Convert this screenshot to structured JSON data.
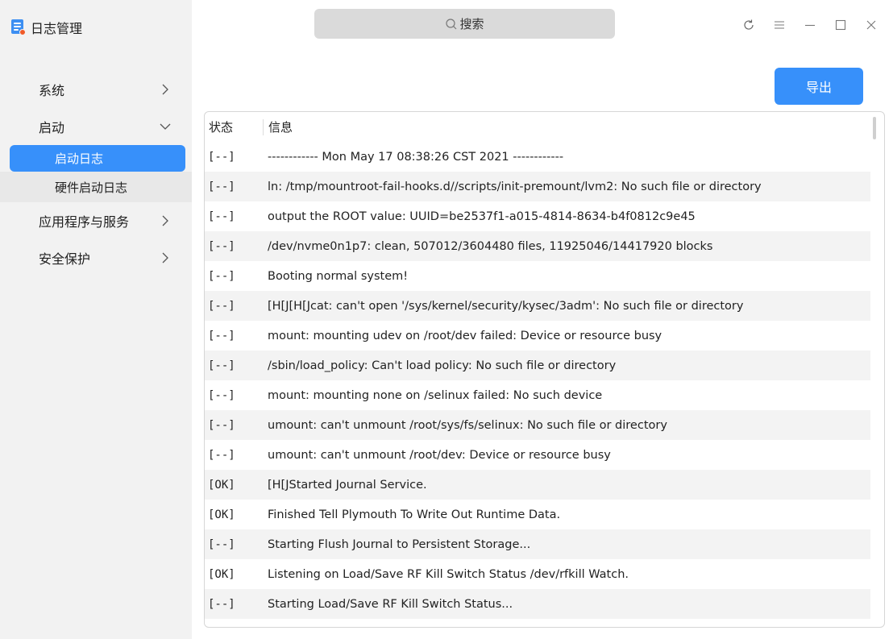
{
  "app": {
    "title": "日志管理"
  },
  "search": {
    "placeholder": "搜索"
  },
  "window_controls": [
    "refresh-icon",
    "menu-icon",
    "minimize-icon",
    "maximize-icon",
    "close-icon"
  ],
  "sidebar": {
    "items": [
      {
        "label": "系统",
        "expanded": false
      },
      {
        "label": "启动",
        "expanded": true,
        "children": [
          {
            "label": "启动日志",
            "active": true
          },
          {
            "label": "硬件启动日志",
            "active": false
          }
        ]
      },
      {
        "label": "应用程序与服务",
        "expanded": false
      },
      {
        "label": "安全保护",
        "expanded": false
      }
    ]
  },
  "toolbar": {
    "export_label": "导出"
  },
  "table": {
    "columns": [
      "状态",
      "信息"
    ],
    "rows": [
      {
        "status": "[--]",
        "info": "------------ Mon May 17 08:38:26 CST 2021 ------------"
      },
      {
        "status": "[--]",
        "info": "ln: /tmp/mountroot-fail-hooks.d//scripts/init-premount/lvm2: No such file or directory"
      },
      {
        "status": "[--]",
        "info": "output the ROOT value: UUID=be2537f1-a015-4814-8634-b4f0812c9e45"
      },
      {
        "status": "[--]",
        "info": "/dev/nvme0n1p7: clean, 507012/3604480 files, 11925046/14417920 blocks"
      },
      {
        "status": "[--]",
        "info": "Booting normal system!"
      },
      {
        "status": "[--]",
        "info": "[H[J[H[Jcat: can't open '/sys/kernel/security/kysec/3adm': No such file or directory"
      },
      {
        "status": "[--]",
        "info": "mount: mounting udev on /root/dev failed: Device or resource busy"
      },
      {
        "status": "[--]",
        "info": "/sbin/load_policy:  Can't load policy:  No such file or directory"
      },
      {
        "status": "[--]",
        "info": "mount: mounting none on /selinux failed: No such device"
      },
      {
        "status": "[--]",
        "info": "umount: can't unmount /root/sys/fs/selinux: No such file or directory"
      },
      {
        "status": "[--]",
        "info": "umount: can't unmount /root/dev: Device or resource busy"
      },
      {
        "status": "[OK]",
        "info": "[H[JStarted  Journal Service."
      },
      {
        "status": "[OK]",
        "info": "Finished  Tell Plymouth To Write Out Runtime Data."
      },
      {
        "status": "[--]",
        "info": "Starting  Flush Journal to Persistent Storage..."
      },
      {
        "status": "[OK]",
        "info": "Listening on  Load/Save RF Kill Switch Status /dev/rfkill Watch."
      },
      {
        "status": "[--]",
        "info": "Starting  Load/Save RF Kill Switch Status..."
      }
    ]
  },
  "colors": {
    "accent": "#3790fa",
    "sidebar_bg": "#f2f2f2",
    "row_alt": "#f3f3f3"
  }
}
